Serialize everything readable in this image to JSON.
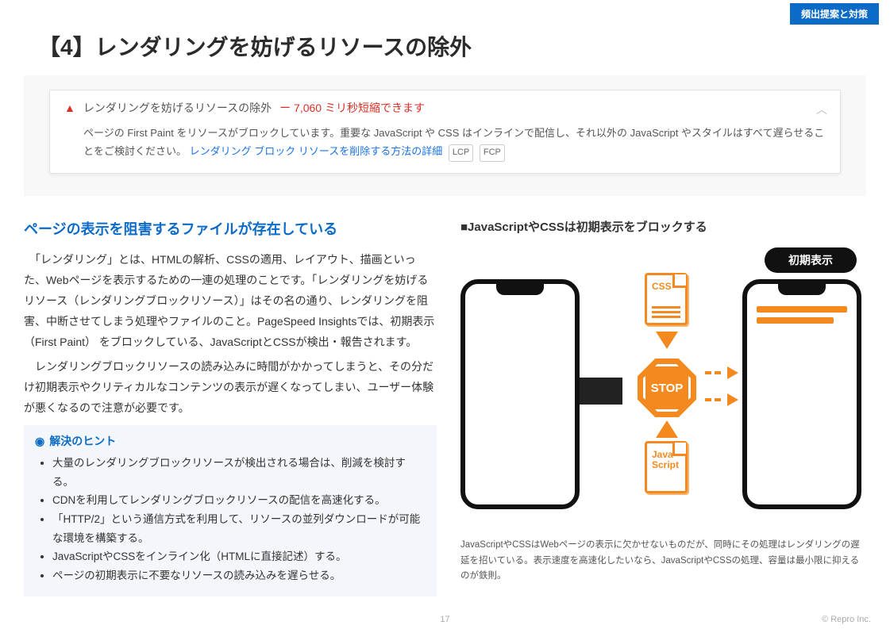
{
  "header": {
    "tag": "頻出提案と対策",
    "title": "【4】レンダリングを妨げるリソースの除外"
  },
  "alert": {
    "heading": "レンダリングを妨げるリソースの除外",
    "savings": "ー 7,060 ミリ秒短縮できます",
    "desc_pre": "ページの First Paint をリソースがブロックしています。重要な JavaScript や CSS はインラインで配信し、それ以外の JavaScript やスタイルはすべて遅らせることをご検討ください。",
    "link": "レンダリング ブロック リソースを削除する方法の詳細",
    "badge1": "LCP",
    "badge2": "FCP"
  },
  "left": {
    "subhead": "ページの表示を阻害するファイルが存在している",
    "p1": "　「レンダリング」とは、HTMLの解析、CSSの適用、レイアウト、描画といった、Webページを表示するための一連の処理のことです。「レンダリングを妨げるリソース（レンダリングブロックリソース）」はその名の通り、レンダリングを阻害、中断させてしまう処理やファイルのこと。PageSpeed Insightsでは、初期表示（First Paint） をブロックしている、JavaScriptとCSSが検出・報告されます。",
    "p2": "　レンダリングブロックリソースの読み込みに時間がかかってしまうと、その分だけ初期表示やクリティカルなコンテンツの表示が遅くなってしまい、ユーザー体験が悪くなるので注意が必要です。",
    "hint_title": "解決のヒント",
    "hints": [
      "大量のレンダリングブロックリソースが検出される場合は、削減を検討する。",
      "CDNを利用してレンダリングブロックリソースの配信を高速化する。",
      "「HTTP/2」という通信方式を利用して、リソースの並列ダウンロードが可能な環境を構築する。",
      "JavaScriptやCSSをインライン化（HTMLに直接記述）する。",
      "ページの初期表示に不要なリソースの読み込みを遅らせる。"
    ]
  },
  "right": {
    "heading": "■JavaScriptやCSSは初期表示をブロックする",
    "init_label": "初期表示",
    "css_label": "CSS",
    "js_label1": "Java",
    "js_label2": "Script",
    "stop": "STOP",
    "caption": "JavaScriptやCSSはWebページの表示に欠かせないものだが、同時にその処理はレンダリングの遅延を招いている。表示速度を高速化したいなら、JavaScriptやCSSの処理、容量は最小限に抑えるのが鉄則。"
  },
  "footer": {
    "page": "17",
    "copyright": "© Repro Inc."
  }
}
